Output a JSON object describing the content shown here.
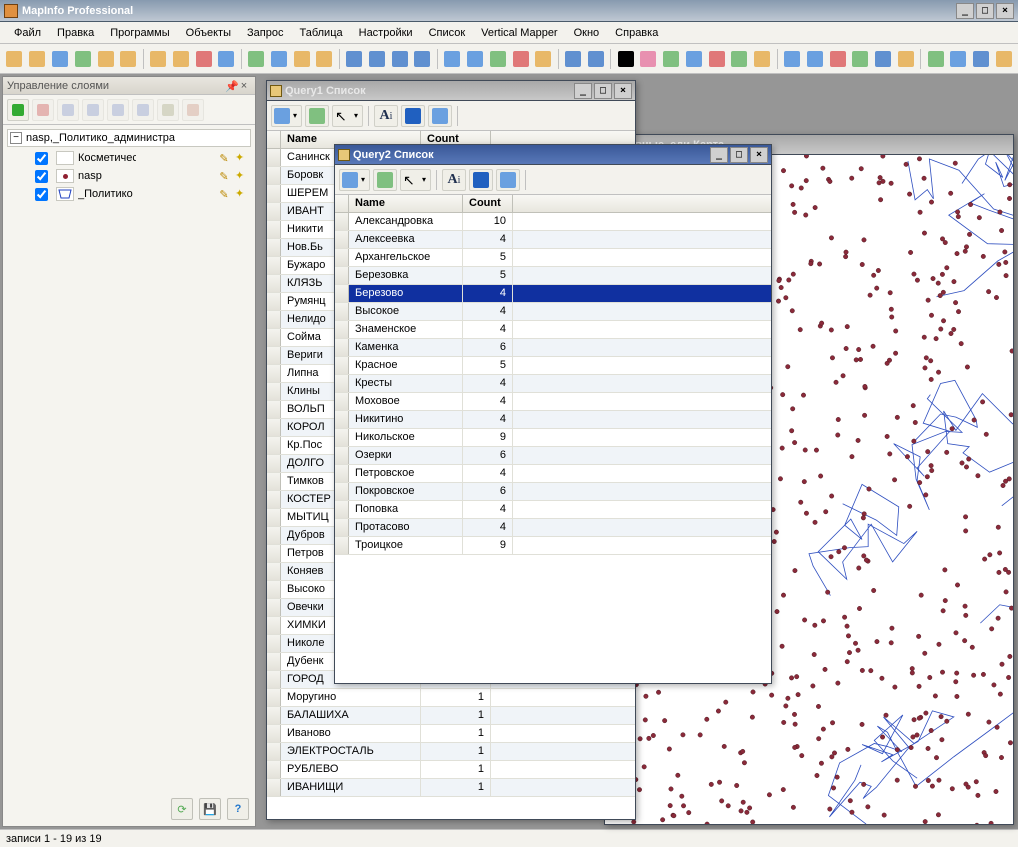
{
  "app_title": "MapInfo Professional",
  "menu": [
    "Файл",
    "Правка",
    "Программы",
    "Объекты",
    "Запрос",
    "Таблица",
    "Настройки",
    "Список",
    "Vertical Mapper",
    "Окно",
    "Справка"
  ],
  "layer_panel": {
    "title": "Управление слоями",
    "root": "nasp,_Политико_администра",
    "layers": [
      {
        "name": "Косметичес",
        "checked": true,
        "sym": "blank"
      },
      {
        "name": "nasp",
        "checked": true,
        "sym": "dot"
      },
      {
        "name": "_Политико",
        "checked": true,
        "sym": "region"
      }
    ]
  },
  "query1": {
    "title": "Query1 Список",
    "headers": [
      "Name",
      "Count"
    ],
    "rows": [
      [
        "Санинск",
        ""
      ],
      [
        "Боровк",
        ""
      ],
      [
        "ШЕРЕМ",
        ""
      ],
      [
        "ИВАНТ",
        ""
      ],
      [
        "Никити",
        ""
      ],
      [
        "Нов.Бь",
        ""
      ],
      [
        "Бужаро",
        ""
      ],
      [
        "КЛЯЗЬ",
        ""
      ],
      [
        "Румянц",
        ""
      ],
      [
        "Нелидо",
        ""
      ],
      [
        "Сойма",
        ""
      ],
      [
        "Вериги",
        ""
      ],
      [
        "Липна",
        ""
      ],
      [
        "Клины",
        ""
      ],
      [
        "ВОЛЬП",
        ""
      ],
      [
        "КОРОЛ",
        ""
      ],
      [
        "Кр.Пос",
        ""
      ],
      [
        "ДОЛГО",
        ""
      ],
      [
        "Тимков",
        ""
      ],
      [
        "КОСТЕР",
        ""
      ],
      [
        "МЫТИЦ",
        ""
      ],
      [
        "Дубров",
        ""
      ],
      [
        "Петров",
        ""
      ],
      [
        "Коняев",
        ""
      ],
      [
        "Высоко",
        ""
      ],
      [
        "Овечки",
        ""
      ],
      [
        "ХИМКИ",
        ""
      ],
      [
        "Николе",
        ""
      ],
      [
        "Дубенк",
        ""
      ],
      [
        "ГОРОД",
        ""
      ],
      [
        "Моругино",
        "1"
      ],
      [
        "БАЛАШИХА",
        "1"
      ],
      [
        "Иваново",
        "1"
      ],
      [
        "ЭЛЕКТРОСТАЛЬ",
        "1"
      ],
      [
        "РУБЛЕВО",
        "1"
      ],
      [
        "ИВАНИЩИ",
        "1"
      ]
    ]
  },
  "query2": {
    "title": "Query2 Список",
    "headers": [
      "Name",
      "Count"
    ],
    "selected_index": 4,
    "rows": [
      [
        "Александровка",
        "10"
      ],
      [
        "Алексеевка",
        "4"
      ],
      [
        "Архангельское",
        "5"
      ],
      [
        "Березовка",
        "5"
      ],
      [
        "Березово",
        "4"
      ],
      [
        "Высокое",
        "4"
      ],
      [
        "Знаменское",
        "4"
      ],
      [
        "Каменка",
        "6"
      ],
      [
        "Красное",
        "5"
      ],
      [
        "Кресты",
        "4"
      ],
      [
        "Моховое",
        "4"
      ],
      [
        "Никитино",
        "4"
      ],
      [
        "Никольское",
        "9"
      ],
      [
        "Озерки",
        "6"
      ],
      [
        "Петровское",
        "4"
      ],
      [
        "Покровское",
        "6"
      ],
      [
        "Поповка",
        "4"
      ],
      [
        "Протасово",
        "4"
      ],
      [
        "Троицкое",
        "9"
      ]
    ]
  },
  "map_window_title": "тивные_еди Карта",
  "status": "записи 1 - 19 из 19"
}
